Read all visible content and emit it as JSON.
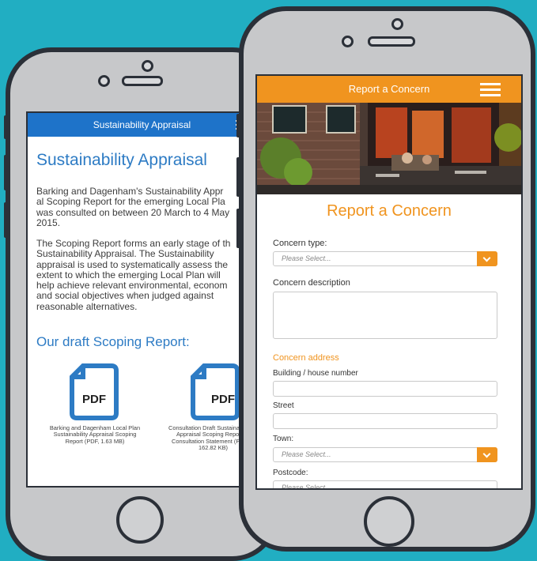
{
  "back_phone": {
    "header_title": "Sustainability Appraisal",
    "page_title": "Sustainability Appraisal",
    "paragraph1": [
      "Barking and Dagenham's Sustainability Appr",
      "al Scoping Report for the emerging Local Pla",
      "was consulted on between 20 March to 4 May",
      "2015."
    ],
    "paragraph2": [
      "The Scoping Report forms an early stage of th",
      "Sustainability Appraisal. The Sustainability",
      "appraisal is used to systematically assess the",
      "extent to which the emerging Local Plan will",
      "help achieve relevant environmental, econom",
      "and social objectives when judged against",
      "reasonable alternatives."
    ],
    "subheading": "Our draft Scoping Report:",
    "documents": [
      {
        "icon_label": "PDF",
        "caption": [
          "Barking and Dagenham Local Plan",
          "Sustainability Appraisal Scoping",
          "Report (PDF, 1.63 MB)"
        ]
      },
      {
        "icon_label": "PDF",
        "caption": [
          "Consultation Draft Sustaina",
          "Appraisal Scoping Repo",
          "Consultation Statement (P",
          "162.82 KB)"
        ]
      }
    ]
  },
  "front_phone": {
    "header_title": "Report a Concern",
    "form_title": "Report a Concern",
    "concern_type": {
      "label": "Concern type:",
      "placeholder": "Please Select..."
    },
    "concern_description": {
      "label": "Concern description"
    },
    "address_heading": "Concern address",
    "building": {
      "label": "Building / house number"
    },
    "street": {
      "label": "Street"
    },
    "town": {
      "label": "Town:",
      "placeholder": "Please Select..."
    },
    "postcode": {
      "label": "Postcode:",
      "placeholder": "Please Select..."
    }
  },
  "colors": {
    "background": "#21aec2",
    "blue_header": "#1e73c9",
    "orange_accent": "#f0941f"
  }
}
